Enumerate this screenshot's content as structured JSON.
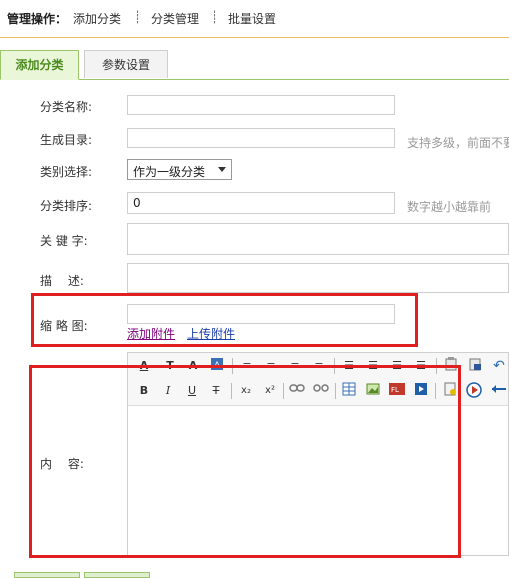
{
  "header": {
    "title": "管理操作：",
    "nav": [
      "添加分类",
      "分类管理",
      "批量设置"
    ],
    "separator": "┊"
  },
  "tabs": [
    {
      "label": "添加分类",
      "active": true
    },
    {
      "label": "参数设置",
      "active": false
    }
  ],
  "form": {
    "name_label": "分类名称:",
    "dir_label": "生成目录:",
    "dir_hint": "支持多级，前面不要",
    "type_label": "类别选择:",
    "type_value": "作为一级分类",
    "sort_label": "分类排序:",
    "sort_value": "0",
    "sort_hint": "数字越小越靠前",
    "keywords_label": "关 键 字:",
    "desc_label": "描　 述:",
    "thumb_label": "缩 略 图:",
    "add_attachment": "添加附件",
    "upload_attachment": "上传附件",
    "content_label": "内　 容:"
  },
  "editor": {
    "row1_icons": [
      "font-family-icon",
      "font-size-icon",
      "font-format-icon",
      "font-color-icon",
      "align-left-icon",
      "align-center-icon",
      "align-right-icon",
      "align-justify-icon",
      "ordered-list-icon",
      "unordered-list-icon",
      "outdent-icon",
      "indent-icon",
      "paste-icon",
      "paste-word-icon",
      "undo-icon"
    ],
    "row2_icons": [
      "bold-icon",
      "italic-icon",
      "underline-icon",
      "strikethrough-icon",
      "subscript-icon",
      "superscript-icon",
      "link-icon",
      "unlink-icon",
      "table-icon",
      "image-icon",
      "flash-icon",
      "media-icon",
      "attachment-icon",
      "flv-icon",
      "horizontal-rule-icon"
    ],
    "glyphs": {
      "font_family": "A̦",
      "font_size": "T",
      "font_format": "A",
      "bold": "B",
      "italic": "I",
      "underline": "U",
      "strike": "T",
      "sub": "x₂",
      "sup": "x²"
    }
  },
  "colors": {
    "accent_green": "#4c8b1f",
    "tab_bg": "#eaf6d8",
    "highlight_red": "#e02020",
    "link_purple": "#800080",
    "link_blue": "#1a3ea8"
  }
}
